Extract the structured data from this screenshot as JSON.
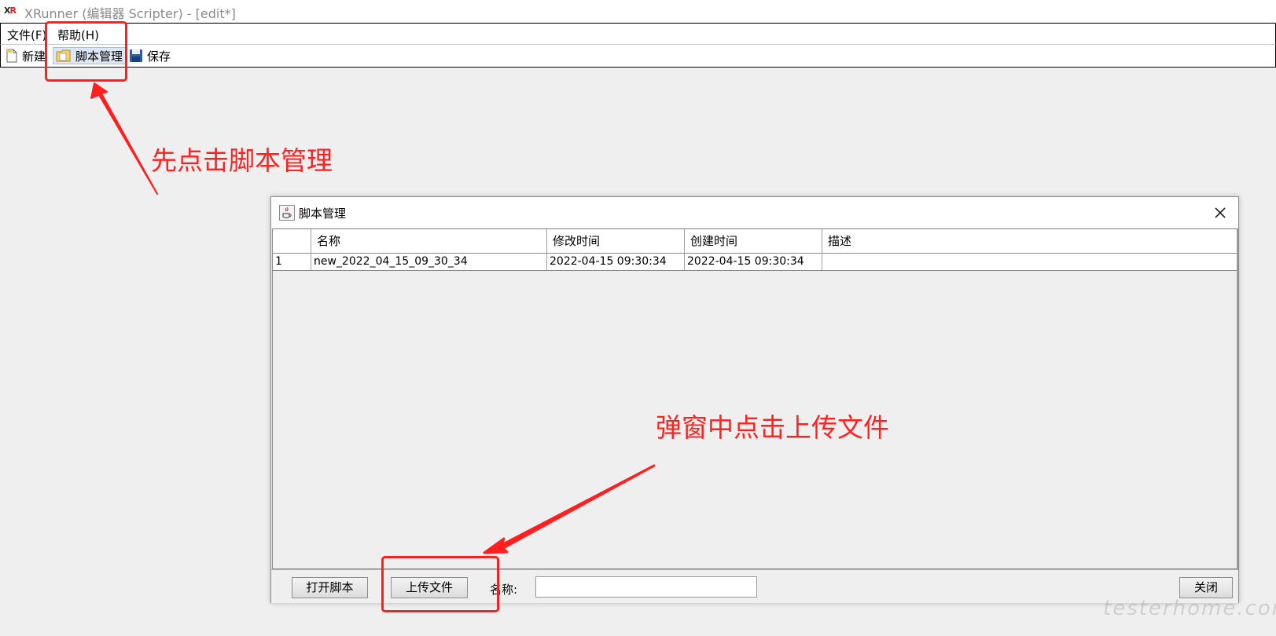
{
  "window": {
    "title": "XRunner (编辑器 Scripter) - [edit*]",
    "logo": {
      "x": "X",
      "r": "R"
    }
  },
  "menubar": {
    "items": [
      "文件(F)",
      "帮助(H)"
    ]
  },
  "toolbar": {
    "new_label": "新建",
    "script_manager_label": "脚本管理",
    "save_label": "保存"
  },
  "dialog": {
    "title": "脚本管理",
    "table": {
      "columns": [
        "",
        "名称",
        "修改时间",
        "创建时间",
        "描述"
      ],
      "rows": [
        [
          "1",
          "new_2022_04_15_09_30_34",
          "2022-04-15 09:30:34",
          "2022-04-15 09:30:34",
          ""
        ]
      ]
    },
    "buttons": {
      "open_script": "打开脚本",
      "upload_file": "上传文件",
      "close": "关闭"
    },
    "name_label": "名称:",
    "name_value": ""
  },
  "annotations": {
    "step1": "先点击脚本管理",
    "step2": "弹窗中点击上传文件",
    "color": "#ff1f1f"
  },
  "watermark": "testerhome.com"
}
